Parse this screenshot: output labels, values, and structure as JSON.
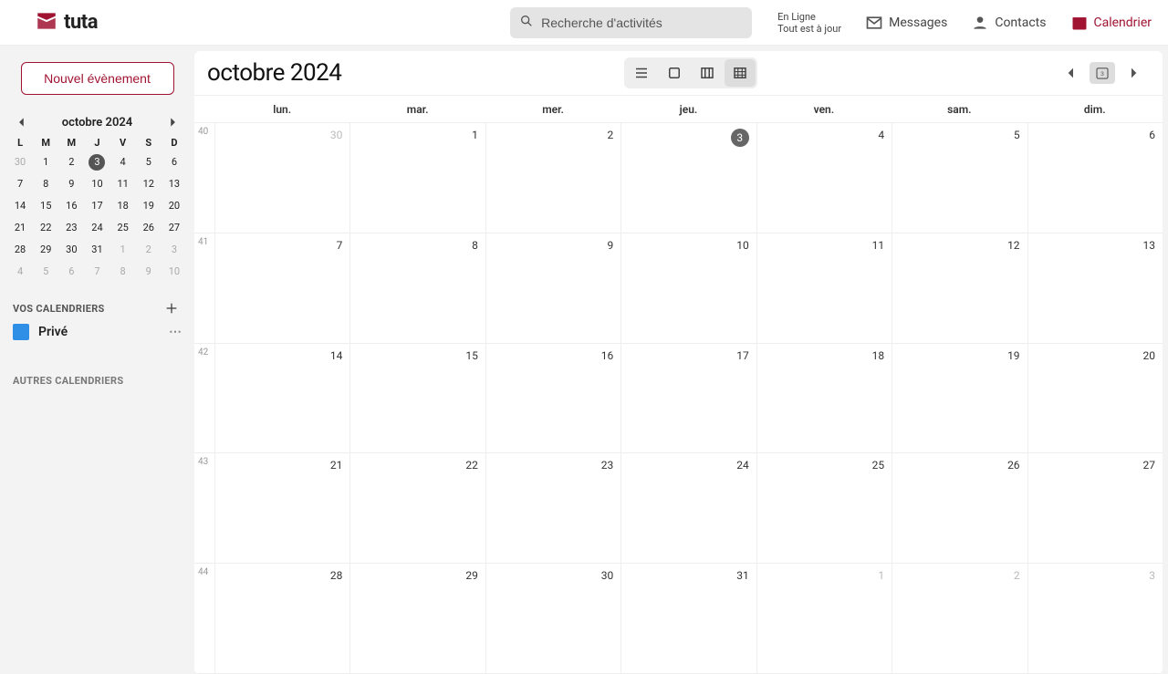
{
  "brand": {
    "name": "tuta"
  },
  "search": {
    "placeholder": "Recherche d'activités"
  },
  "status": {
    "line1": "En Ligne",
    "line2": "Tout est à jour"
  },
  "topnav": {
    "messages": "Messages",
    "contacts": "Contacts",
    "calendar": "Calendrier"
  },
  "sidebar": {
    "new_event": "Nouvel évènement",
    "mini_title": "octobre 2024",
    "dow": [
      "L",
      "M",
      "M",
      "J",
      "V",
      "S",
      "D"
    ],
    "mini_rows": [
      [
        {
          "n": "30",
          "o": true
        },
        {
          "n": "1"
        },
        {
          "n": "2"
        },
        {
          "n": "3",
          "t": true
        },
        {
          "n": "4"
        },
        {
          "n": "5"
        },
        {
          "n": "6"
        }
      ],
      [
        {
          "n": "7"
        },
        {
          "n": "8"
        },
        {
          "n": "9"
        },
        {
          "n": "10"
        },
        {
          "n": "11"
        },
        {
          "n": "12"
        },
        {
          "n": "13"
        }
      ],
      [
        {
          "n": "14"
        },
        {
          "n": "15"
        },
        {
          "n": "16"
        },
        {
          "n": "17"
        },
        {
          "n": "18"
        },
        {
          "n": "19"
        },
        {
          "n": "20"
        }
      ],
      [
        {
          "n": "21"
        },
        {
          "n": "22"
        },
        {
          "n": "23"
        },
        {
          "n": "24"
        },
        {
          "n": "25"
        },
        {
          "n": "26"
        },
        {
          "n": "27"
        }
      ],
      [
        {
          "n": "28"
        },
        {
          "n": "29"
        },
        {
          "n": "30"
        },
        {
          "n": "31"
        },
        {
          "n": "1",
          "o": true
        },
        {
          "n": "2",
          "o": true
        },
        {
          "n": "3",
          "o": true
        }
      ],
      [
        {
          "n": "4",
          "o": true
        },
        {
          "n": "5",
          "o": true
        },
        {
          "n": "6",
          "o": true
        },
        {
          "n": "7",
          "o": true
        },
        {
          "n": "8",
          "o": true
        },
        {
          "n": "9",
          "o": true
        },
        {
          "n": "10",
          "o": true
        }
      ]
    ],
    "your_calendars": "VOS CALENDRIERS",
    "calendars": [
      {
        "name": "Privé",
        "color": "#2f8fe6"
      }
    ],
    "other_calendars": "AUTRES CALENDRIERS"
  },
  "main": {
    "title": "octobre 2024",
    "today_badge": "3",
    "dow": [
      "lun.",
      "mar.",
      "mer.",
      "jeu.",
      "ven.",
      "sam.",
      "dim."
    ],
    "weeks": [
      {
        "no": "40",
        "days": [
          {
            "n": "30",
            "o": true
          },
          {
            "n": "1"
          },
          {
            "n": "2"
          },
          {
            "n": "3",
            "t": true
          },
          {
            "n": "4"
          },
          {
            "n": "5"
          },
          {
            "n": "6"
          }
        ]
      },
      {
        "no": "41",
        "days": [
          {
            "n": "7"
          },
          {
            "n": "8"
          },
          {
            "n": "9"
          },
          {
            "n": "10"
          },
          {
            "n": "11"
          },
          {
            "n": "12"
          },
          {
            "n": "13"
          }
        ]
      },
      {
        "no": "42",
        "days": [
          {
            "n": "14"
          },
          {
            "n": "15"
          },
          {
            "n": "16"
          },
          {
            "n": "17"
          },
          {
            "n": "18"
          },
          {
            "n": "19"
          },
          {
            "n": "20"
          }
        ]
      },
      {
        "no": "43",
        "days": [
          {
            "n": "21"
          },
          {
            "n": "22"
          },
          {
            "n": "23"
          },
          {
            "n": "24"
          },
          {
            "n": "25"
          },
          {
            "n": "26"
          },
          {
            "n": "27"
          }
        ]
      },
      {
        "no": "44",
        "days": [
          {
            "n": "28"
          },
          {
            "n": "29"
          },
          {
            "n": "30"
          },
          {
            "n": "31"
          },
          {
            "n": "1",
            "o": true
          },
          {
            "n": "2",
            "o": true
          },
          {
            "n": "3",
            "o": true
          }
        ]
      }
    ]
  }
}
